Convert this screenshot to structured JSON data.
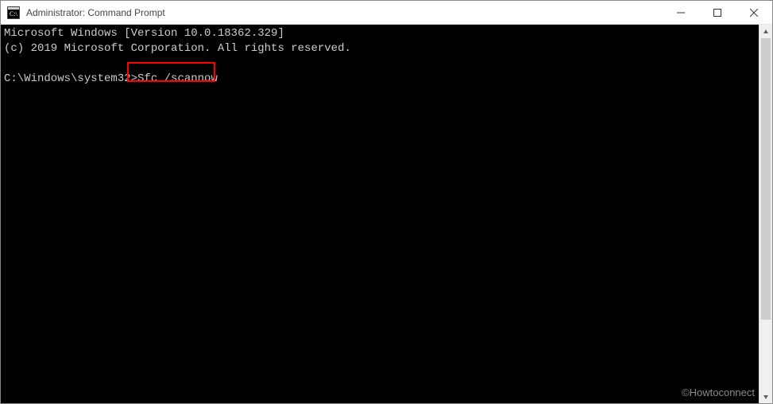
{
  "window": {
    "title": "Administrator: Command Prompt"
  },
  "terminal": {
    "line1": "Microsoft Windows [Version 10.0.18362.329]",
    "line2": "(c) 2019 Microsoft Corporation. All rights reserved.",
    "blank": "",
    "prompt": "C:\\Windows\\system32>",
    "command": "Sfc /scannow"
  },
  "watermark": "©Howtoconnect"
}
